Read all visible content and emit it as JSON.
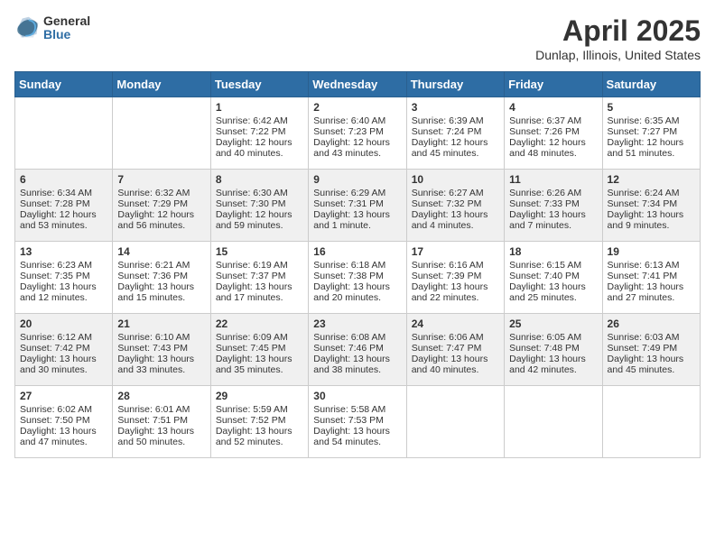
{
  "header": {
    "logo_line1": "General",
    "logo_line2": "Blue",
    "title": "April 2025",
    "subtitle": "Dunlap, Illinois, United States"
  },
  "weekdays": [
    "Sunday",
    "Monday",
    "Tuesday",
    "Wednesday",
    "Thursday",
    "Friday",
    "Saturday"
  ],
  "weeks": [
    [
      {
        "day": "",
        "sunrise": "",
        "sunset": "",
        "daylight": ""
      },
      {
        "day": "",
        "sunrise": "",
        "sunset": "",
        "daylight": ""
      },
      {
        "day": "1",
        "sunrise": "Sunrise: 6:42 AM",
        "sunset": "Sunset: 7:22 PM",
        "daylight": "Daylight: 12 hours and 40 minutes."
      },
      {
        "day": "2",
        "sunrise": "Sunrise: 6:40 AM",
        "sunset": "Sunset: 7:23 PM",
        "daylight": "Daylight: 12 hours and 43 minutes."
      },
      {
        "day": "3",
        "sunrise": "Sunrise: 6:39 AM",
        "sunset": "Sunset: 7:24 PM",
        "daylight": "Daylight: 12 hours and 45 minutes."
      },
      {
        "day": "4",
        "sunrise": "Sunrise: 6:37 AM",
        "sunset": "Sunset: 7:26 PM",
        "daylight": "Daylight: 12 hours and 48 minutes."
      },
      {
        "day": "5",
        "sunrise": "Sunrise: 6:35 AM",
        "sunset": "Sunset: 7:27 PM",
        "daylight": "Daylight: 12 hours and 51 minutes."
      }
    ],
    [
      {
        "day": "6",
        "sunrise": "Sunrise: 6:34 AM",
        "sunset": "Sunset: 7:28 PM",
        "daylight": "Daylight: 12 hours and 53 minutes."
      },
      {
        "day": "7",
        "sunrise": "Sunrise: 6:32 AM",
        "sunset": "Sunset: 7:29 PM",
        "daylight": "Daylight: 12 hours and 56 minutes."
      },
      {
        "day": "8",
        "sunrise": "Sunrise: 6:30 AM",
        "sunset": "Sunset: 7:30 PM",
        "daylight": "Daylight: 12 hours and 59 minutes."
      },
      {
        "day": "9",
        "sunrise": "Sunrise: 6:29 AM",
        "sunset": "Sunset: 7:31 PM",
        "daylight": "Daylight: 13 hours and 1 minute."
      },
      {
        "day": "10",
        "sunrise": "Sunrise: 6:27 AM",
        "sunset": "Sunset: 7:32 PM",
        "daylight": "Daylight: 13 hours and 4 minutes."
      },
      {
        "day": "11",
        "sunrise": "Sunrise: 6:26 AM",
        "sunset": "Sunset: 7:33 PM",
        "daylight": "Daylight: 13 hours and 7 minutes."
      },
      {
        "day": "12",
        "sunrise": "Sunrise: 6:24 AM",
        "sunset": "Sunset: 7:34 PM",
        "daylight": "Daylight: 13 hours and 9 minutes."
      }
    ],
    [
      {
        "day": "13",
        "sunrise": "Sunrise: 6:23 AM",
        "sunset": "Sunset: 7:35 PM",
        "daylight": "Daylight: 13 hours and 12 minutes."
      },
      {
        "day": "14",
        "sunrise": "Sunrise: 6:21 AM",
        "sunset": "Sunset: 7:36 PM",
        "daylight": "Daylight: 13 hours and 15 minutes."
      },
      {
        "day": "15",
        "sunrise": "Sunrise: 6:19 AM",
        "sunset": "Sunset: 7:37 PM",
        "daylight": "Daylight: 13 hours and 17 minutes."
      },
      {
        "day": "16",
        "sunrise": "Sunrise: 6:18 AM",
        "sunset": "Sunset: 7:38 PM",
        "daylight": "Daylight: 13 hours and 20 minutes."
      },
      {
        "day": "17",
        "sunrise": "Sunrise: 6:16 AM",
        "sunset": "Sunset: 7:39 PM",
        "daylight": "Daylight: 13 hours and 22 minutes."
      },
      {
        "day": "18",
        "sunrise": "Sunrise: 6:15 AM",
        "sunset": "Sunset: 7:40 PM",
        "daylight": "Daylight: 13 hours and 25 minutes."
      },
      {
        "day": "19",
        "sunrise": "Sunrise: 6:13 AM",
        "sunset": "Sunset: 7:41 PM",
        "daylight": "Daylight: 13 hours and 27 minutes."
      }
    ],
    [
      {
        "day": "20",
        "sunrise": "Sunrise: 6:12 AM",
        "sunset": "Sunset: 7:42 PM",
        "daylight": "Daylight: 13 hours and 30 minutes."
      },
      {
        "day": "21",
        "sunrise": "Sunrise: 6:10 AM",
        "sunset": "Sunset: 7:43 PM",
        "daylight": "Daylight: 13 hours and 33 minutes."
      },
      {
        "day": "22",
        "sunrise": "Sunrise: 6:09 AM",
        "sunset": "Sunset: 7:45 PM",
        "daylight": "Daylight: 13 hours and 35 minutes."
      },
      {
        "day": "23",
        "sunrise": "Sunrise: 6:08 AM",
        "sunset": "Sunset: 7:46 PM",
        "daylight": "Daylight: 13 hours and 38 minutes."
      },
      {
        "day": "24",
        "sunrise": "Sunrise: 6:06 AM",
        "sunset": "Sunset: 7:47 PM",
        "daylight": "Daylight: 13 hours and 40 minutes."
      },
      {
        "day": "25",
        "sunrise": "Sunrise: 6:05 AM",
        "sunset": "Sunset: 7:48 PM",
        "daylight": "Daylight: 13 hours and 42 minutes."
      },
      {
        "day": "26",
        "sunrise": "Sunrise: 6:03 AM",
        "sunset": "Sunset: 7:49 PM",
        "daylight": "Daylight: 13 hours and 45 minutes."
      }
    ],
    [
      {
        "day": "27",
        "sunrise": "Sunrise: 6:02 AM",
        "sunset": "Sunset: 7:50 PM",
        "daylight": "Daylight: 13 hours and 47 minutes."
      },
      {
        "day": "28",
        "sunrise": "Sunrise: 6:01 AM",
        "sunset": "Sunset: 7:51 PM",
        "daylight": "Daylight: 13 hours and 50 minutes."
      },
      {
        "day": "29",
        "sunrise": "Sunrise: 5:59 AM",
        "sunset": "Sunset: 7:52 PM",
        "daylight": "Daylight: 13 hours and 52 minutes."
      },
      {
        "day": "30",
        "sunrise": "Sunrise: 5:58 AM",
        "sunset": "Sunset: 7:53 PM",
        "daylight": "Daylight: 13 hours and 54 minutes."
      },
      {
        "day": "",
        "sunrise": "",
        "sunset": "",
        "daylight": ""
      },
      {
        "day": "",
        "sunrise": "",
        "sunset": "",
        "daylight": ""
      },
      {
        "day": "",
        "sunrise": "",
        "sunset": "",
        "daylight": ""
      }
    ]
  ]
}
